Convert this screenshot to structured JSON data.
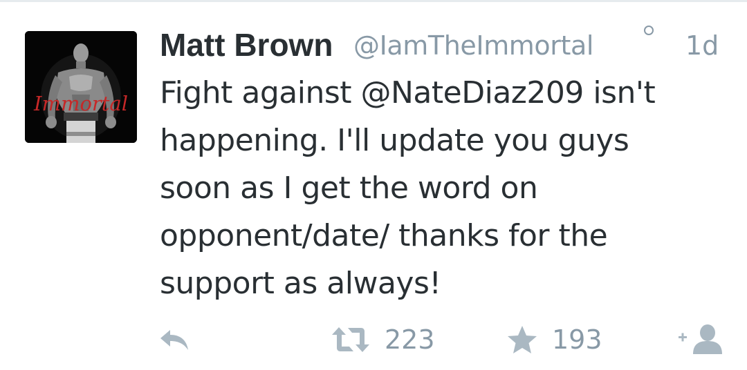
{
  "avatar": {
    "overlay_text": "Immortal",
    "accent_color": "#c62828"
  },
  "tweet": {
    "display_name": "Matt Brown",
    "handle": "@IamTheImmortal",
    "timestamp": "1d",
    "text_lines": [
      "Fight against @NateDiaz209 isn't",
      "happening. I'll update you guys",
      "soon as I get the word on",
      "opponent/date/ thanks for the",
      "support as always!"
    ]
  },
  "actions": {
    "reply_icon": "reply-icon",
    "retweet_icon": "retweet-icon",
    "retweet_count": "223",
    "favorite_icon": "star-icon",
    "favorite_count": "193",
    "follow_icon": "add-user-icon"
  },
  "colors": {
    "primary_text": "#292f33",
    "secondary_text": "#8899a6",
    "action_icon": "#aab8c2"
  }
}
